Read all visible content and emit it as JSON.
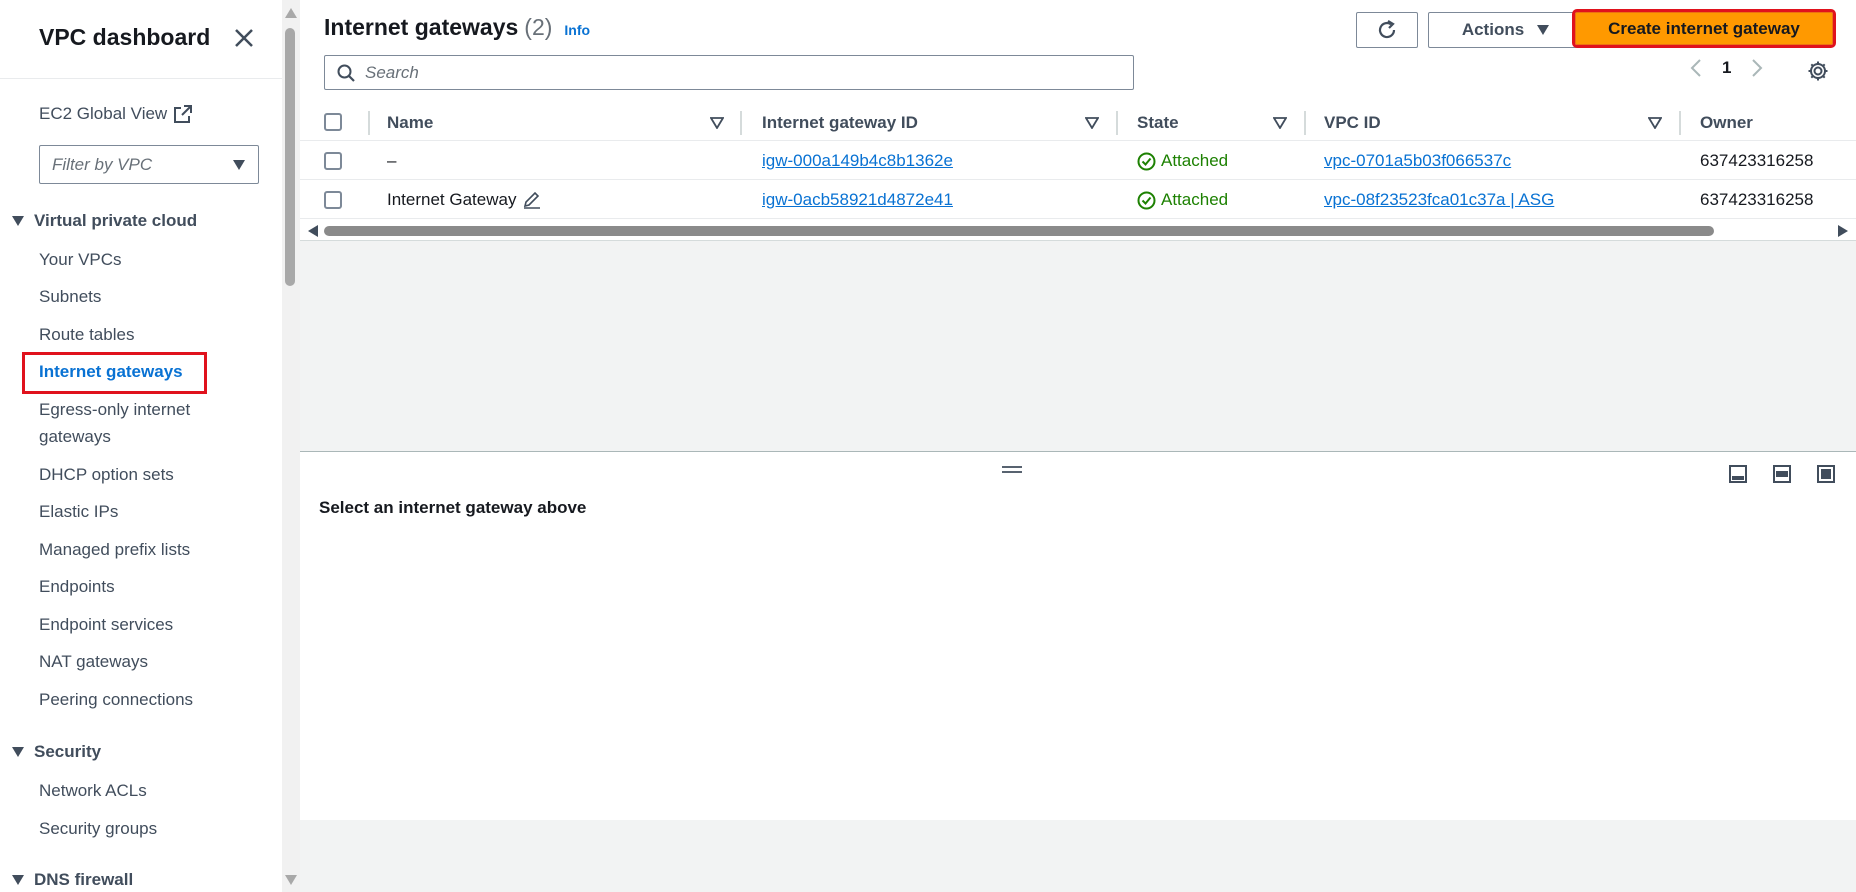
{
  "sidebar": {
    "header": "VPC dashboard",
    "close_icon": "close-icon",
    "ec2_global_view": "EC2 Global View",
    "filter_placeholder": "Filter by VPC",
    "sections": [
      {
        "title": "Virtual private cloud",
        "items": [
          "Your VPCs",
          "Subnets",
          "Route tables",
          "Internet gateways",
          "Egress-only internet gateways",
          "DHCP option sets",
          "Elastic IPs",
          "Managed prefix lists",
          "Endpoints",
          "Endpoint services",
          "NAT gateways",
          "Peering connections"
        ]
      },
      {
        "title": "Security",
        "items": [
          "Network ACLs",
          "Security groups"
        ]
      },
      {
        "title": "DNS firewall",
        "items": []
      }
    ],
    "active_item": "Internet gateways"
  },
  "header": {
    "title": "Internet gateways",
    "count": "(2)",
    "info": "Info"
  },
  "toolbar": {
    "actions_label": "Actions",
    "create_label": "Create internet gateway"
  },
  "search": {
    "placeholder": "Search"
  },
  "pagination": {
    "current_page": "1"
  },
  "table": {
    "columns": [
      "Name",
      "Internet gateway ID",
      "State",
      "VPC ID",
      "Owner"
    ],
    "rows": [
      {
        "name": "–",
        "igw_id": "igw-000a149b4c8b1362e",
        "state": "Attached",
        "vpc_id": "vpc-0701a5b03f066537c",
        "owner": "637423316258"
      },
      {
        "name": "Internet Gateway",
        "igw_id": "igw-0acb58921d4872e41",
        "state": "Attached",
        "vpc_id": "vpc-08f23523fca01c37a | ASG",
        "owner": "637423316258"
      }
    ]
  },
  "split_panel": {
    "message": "Select an internet gateway above"
  },
  "colors": {
    "accent": "#0972d3",
    "primary_button": "#ff9900",
    "success": "#1d8102",
    "highlight": "#e0121d"
  }
}
